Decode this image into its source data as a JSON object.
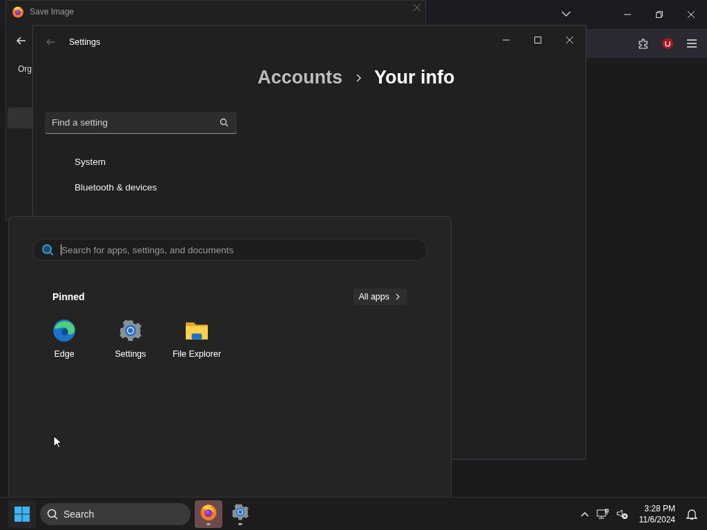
{
  "save_dialog": {
    "title": "Save Image",
    "toolbar_label": "Org"
  },
  "settings": {
    "title": "Settings",
    "breadcrumb": [
      {
        "label": "Accounts",
        "current": false
      },
      {
        "label": "Your info",
        "current": true
      }
    ],
    "search": {
      "placeholder": "Find a setting"
    },
    "nav": [
      {
        "label": "System"
      },
      {
        "label": "Bluetooth & devices"
      }
    ]
  },
  "start_menu": {
    "search": {
      "placeholder": "Search for apps, settings, and documents"
    },
    "pinned_title": "Pinned",
    "all_apps": "All apps",
    "pinned": [
      {
        "label": "Edge",
        "kind": "edge"
      },
      {
        "label": "Settings",
        "kind": "settings"
      },
      {
        "label": "File Explorer",
        "kind": "explorer"
      }
    ]
  },
  "taskbar": {
    "search": {
      "placeholder": "Search"
    },
    "apps": [
      {
        "kind": "firefox",
        "selected": true
      },
      {
        "kind": "settings",
        "selected": false
      }
    ],
    "time": "3:28 PM",
    "date": "11/6/2024"
  }
}
